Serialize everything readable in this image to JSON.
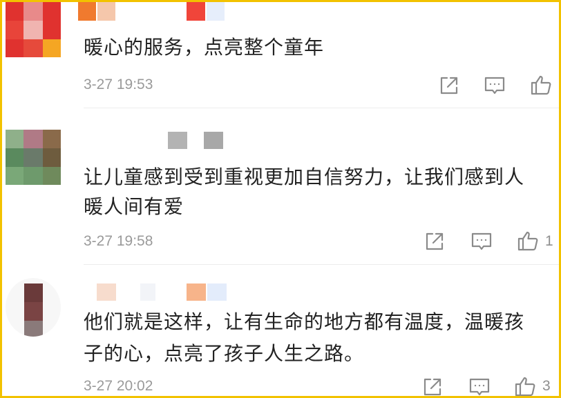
{
  "colors": {
    "border": "#f2c200",
    "text": "#222222",
    "time": "#9a9a9a",
    "icon": "#8a8a8a"
  },
  "icons": [
    "share-icon",
    "reply-icon",
    "like-icon"
  ],
  "comments": [
    {
      "text": "暖心的服务，点亮整个童年",
      "time": "3-27 19:53",
      "likes": ""
    },
    {
      "text_line1": "让儿童感到受到重视更加自信努力，让我们感到人",
      "text_line2": "暖人间有爱",
      "time": "3-27 19:58",
      "likes": "1"
    },
    {
      "text_line1": "他们就是这样，让有生命的地方都有温度，温暖孩",
      "text_line2": "子的心，点亮了孩子人生之路。",
      "time": "3-27 20:02",
      "likes": "3"
    }
  ]
}
